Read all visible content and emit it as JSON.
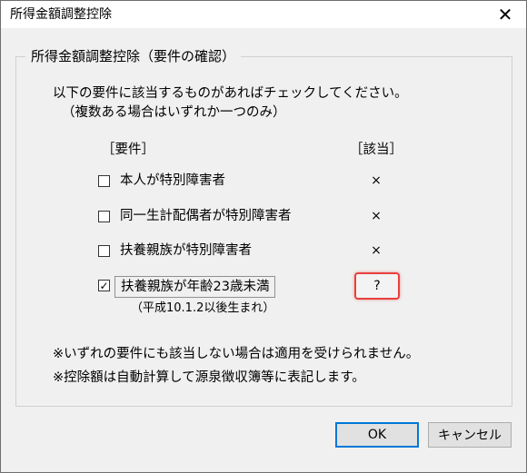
{
  "window": {
    "title": "所得金額調整控除",
    "close_glyph": "✕"
  },
  "group": {
    "legend": "所得金額調整控除（要件の確認）"
  },
  "instructions": {
    "line1": "以下の要件に該当するものがあればチェックしてください。",
    "line2": "（複数ある場合はいずれか一つのみ）"
  },
  "headers": {
    "requirement": "［要件］",
    "applicable": "［該当］"
  },
  "rows": [
    {
      "label": "本人が特別障害者",
      "checked": false,
      "check_glyph": "",
      "mark": "×"
    },
    {
      "label": "同一生計配偶者が特別障害者",
      "checked": false,
      "check_glyph": "",
      "mark": "×"
    },
    {
      "label": "扶養親族が特別障害者",
      "checked": false,
      "check_glyph": "",
      "mark": "×"
    },
    {
      "label": "扶養親族が年齢23歳未満",
      "checked": true,
      "check_glyph": "✓",
      "mark": "?"
    }
  ],
  "row4_note": "（平成10.1.2以後生まれ）",
  "notes": {
    "line1": "※いずれの要件にも該当しない場合は適用を受けられません。",
    "line2": "※控除額は自動計算して源泉徴収簿等に表記します。"
  },
  "buttons": {
    "ok": "OK",
    "cancel": "キャンセル"
  },
  "colors": {
    "highlight": "#e8403e",
    "focus": "#0078d7"
  }
}
